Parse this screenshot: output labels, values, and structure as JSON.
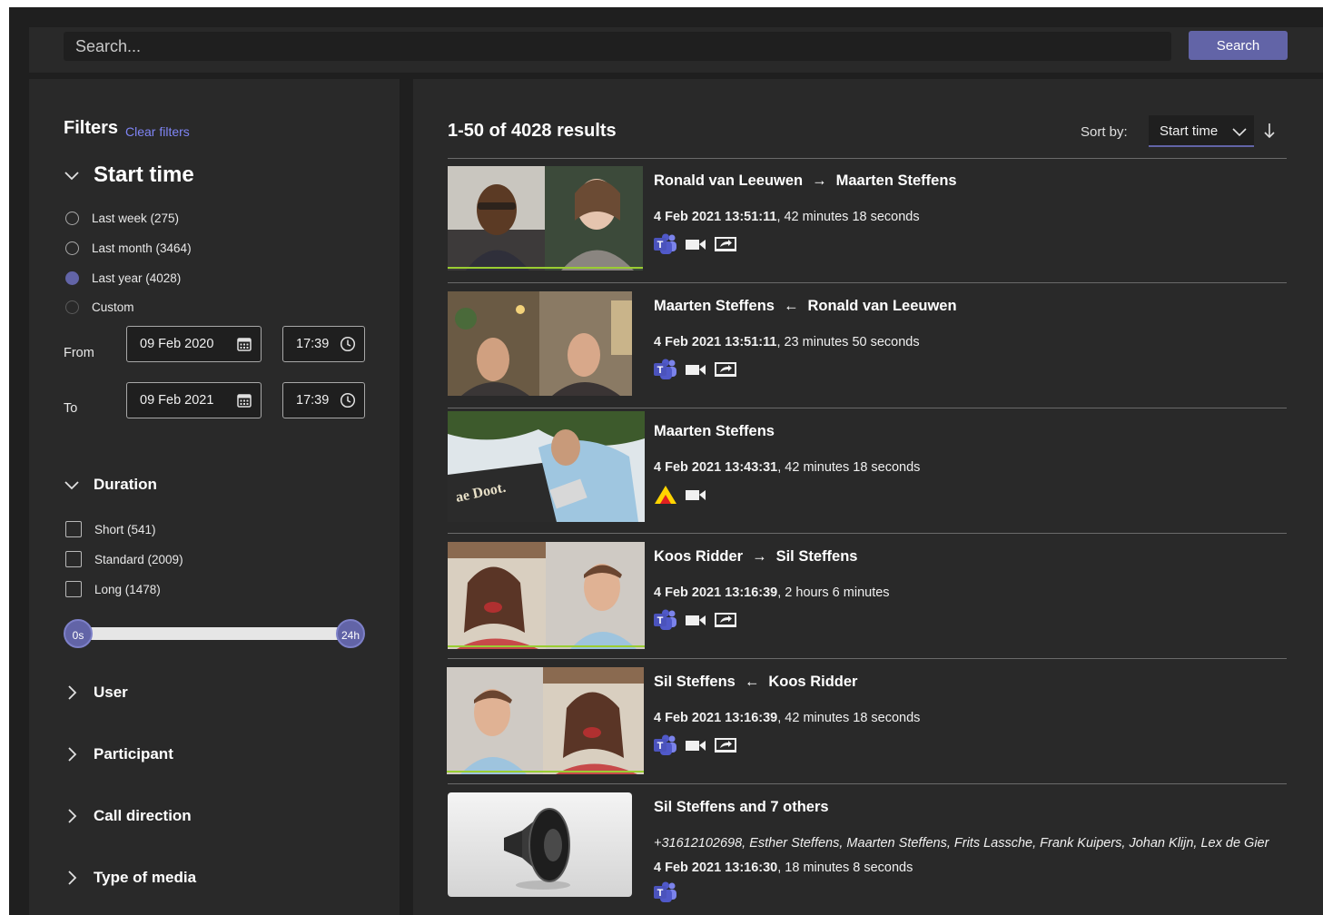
{
  "search": {
    "placeholder": "Search...",
    "button_label": "Search"
  },
  "filters": {
    "title": "Filters",
    "clear_label": "Clear filters",
    "start_time": {
      "heading": "Start time",
      "options": [
        {
          "label": "Last week (275)",
          "checked": false
        },
        {
          "label": "Last month (3464)",
          "checked": false
        },
        {
          "label": "Last year (4028)",
          "checked": true
        },
        {
          "label": "Custom",
          "checked": false
        }
      ],
      "from_label": "From",
      "to_label": "To",
      "from_date": "09 Feb 2020",
      "from_time": "17:39",
      "to_date": "09 Feb 2021",
      "to_time": "17:39"
    },
    "duration": {
      "heading": "Duration",
      "options": [
        {
          "label": "Short (541)",
          "checked": false
        },
        {
          "label": "Standard (2009)",
          "checked": false
        },
        {
          "label": "Long (1478)",
          "checked": false
        }
      ],
      "slider_min_label": "0s",
      "slider_max_label": "24h"
    },
    "collapsed_sections": [
      "User",
      "Participant",
      "Call direction",
      "Type of media"
    ]
  },
  "results": {
    "count_label": "1-50 of 4028 results",
    "sort_label": "Sort by:",
    "sort_value": "Start time",
    "items": [
      {
        "from": "Ronald van Leeuwen",
        "arrow": "→",
        "to": "Maarten Steffens",
        "date": "4 Feb 2021 13:51:11",
        "duration": ", 42 minutes 18 seconds",
        "icons": [
          "teams-icon",
          "video-icon",
          "screen-share-icon"
        ]
      },
      {
        "from": "Maarten Steffens",
        "arrow": "←",
        "to": "Ronald van Leeuwen",
        "date": "4 Feb 2021 13:51:11",
        "duration": ", 23 minutes 50 seconds",
        "icons": [
          "teams-icon",
          "video-icon",
          "screen-share-icon"
        ]
      },
      {
        "from": "Maarten Steffens",
        "arrow": "",
        "to": "",
        "date": "4 Feb 2021 13:43:31",
        "duration": ", 42 minutes 18 seconds",
        "icons": [
          "warning-icon",
          "video-icon"
        ]
      },
      {
        "from": "Koos Ridder",
        "arrow": "→",
        "to": "Sil Steffens",
        "date": "4 Feb 2021 13:16:39",
        "duration": ", 2 hours 6 minutes",
        "icons": [
          "teams-icon",
          "video-icon",
          "screen-share-icon"
        ]
      },
      {
        "from": "Sil Steffens",
        "arrow": "←",
        "to": "Koos Ridder",
        "date": "4 Feb 2021 13:16:39",
        "duration": ", 42 minutes 18 seconds",
        "icons": [
          "teams-icon",
          "video-icon",
          "screen-share-icon"
        ]
      },
      {
        "from": "Sil Steffens and 7 others",
        "arrow": "",
        "to": "",
        "participants": "+31612102698, Esther Steffens, Maarten Steffens, Frits Lassche, Frank Kuipers, Johan Klijn, Lex de Gier",
        "date": "4 Feb 2021 13:16:30",
        "duration": ", 18 minutes 8 seconds",
        "icons": [
          "teams-icon"
        ]
      }
    ]
  },
  "colors": {
    "accent": "#6264a7",
    "link": "#7f85f5",
    "panel": "#292929",
    "background": "#1f1f1f"
  }
}
